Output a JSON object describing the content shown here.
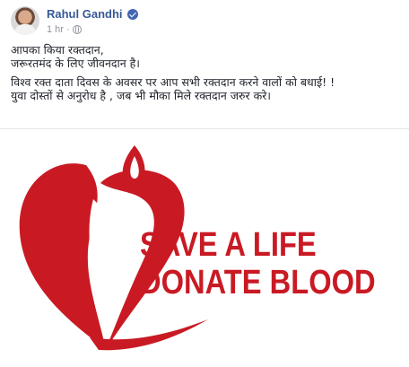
{
  "post": {
    "author": "Rahul Gandhi",
    "time": "1 hr",
    "separator": "·",
    "privacy_icon": "globe-icon",
    "verified_icon": "verified-badge-icon",
    "paragraphs": [
      [
        "आपका किया रक्तदान,",
        "जरूरतमंद के लिए जीवनदान है।"
      ],
      [
        "विश्व रक्त दाता दिवस के अवसर पर आप सभी रक्तदान करने वालों को बधाई! !",
        "युवा दोस्तों से अनुरोध है , जब भी मौका मिले रक्तदान जरुर करे।"
      ]
    ]
  },
  "image": {
    "slogan_line1": "SAVE A LIFE",
    "slogan_line2": "DONATE BLOOD",
    "accent_color": "#c91a24"
  },
  "colors": {
    "author": "#385898",
    "text": "#1d2129",
    "meta": "#90949c",
    "verified": "#4267b2"
  }
}
